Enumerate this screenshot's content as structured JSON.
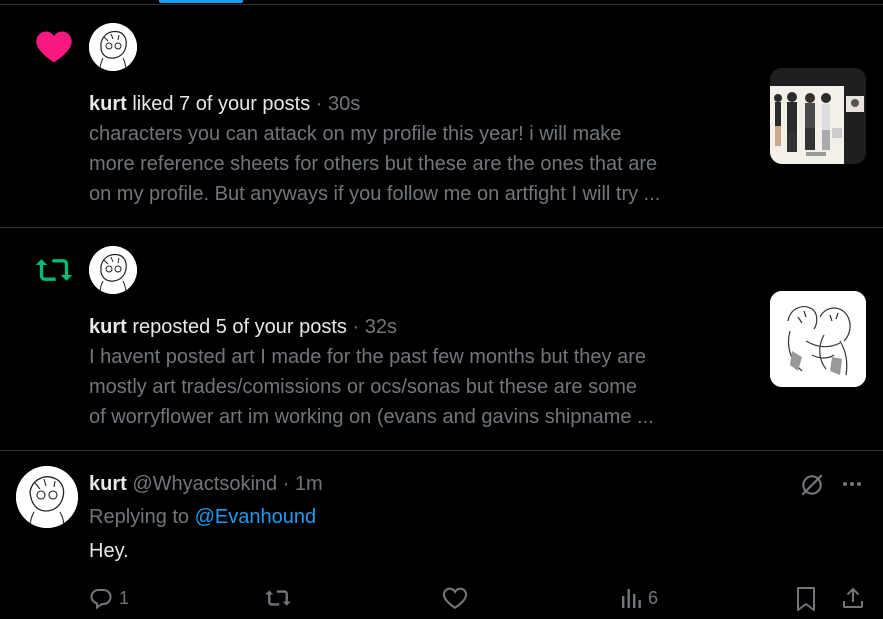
{
  "colors": {
    "background": "#000000",
    "divider": "#2f3336",
    "accent": "#1d9bf0",
    "like": "#f91880",
    "repost": "#00ba7c",
    "muted": "#71767b",
    "text": "#e7e9ea"
  },
  "notifications": [
    {
      "type_icon": "heart-icon",
      "name": "kurt",
      "verb": " liked 7 of your posts",
      "time": " · 30s",
      "excerpt": [
        "characters you can attack on my profile this year! i will make",
        "more reference sheets for others but these are the ones that are",
        "on my profile. But anyways if you follow me on artfight I will try ..."
      ]
    },
    {
      "type_icon": "repost-icon",
      "name": "kurt",
      "verb": " reposted 5 of your posts",
      "time": " · 32s",
      "excerpt": [
        "I havent posted art I made for the past few months but they are",
        "mostly art trades/comissions or ocs/sonas but these are some",
        "of worryflower art im working on (evans and gavins shipname ..."
      ]
    }
  ],
  "tweet": {
    "name": "kurt",
    "handle": " @Whyactsokind",
    "time": " · 1m",
    "replying_prefix": "Replying to ",
    "mention": "@Evanhound",
    "text": "Hey.",
    "actions": {
      "reply_count": "1",
      "repost_count": "",
      "like_count": "",
      "views_count": "6"
    }
  }
}
